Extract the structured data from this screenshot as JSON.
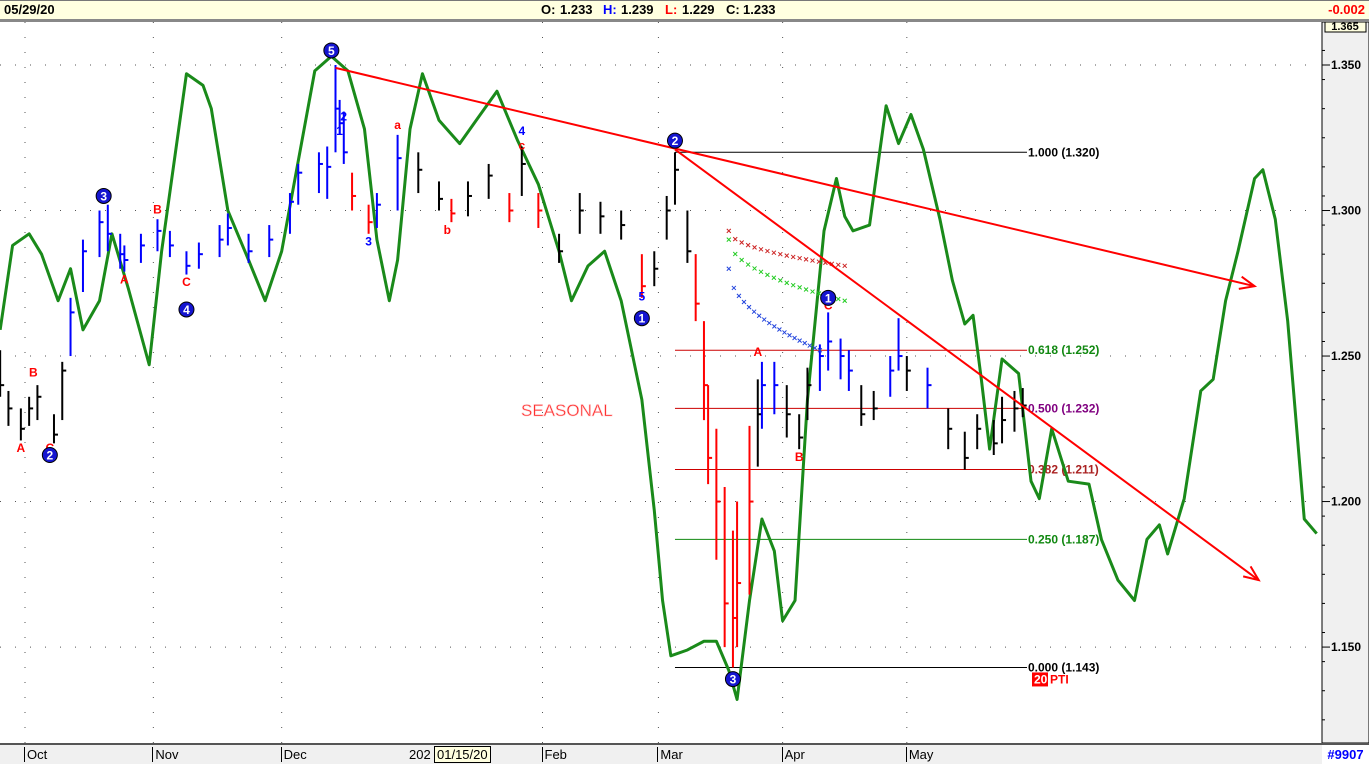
{
  "header": {
    "date": "05/29/20",
    "ohlc": {
      "o_label": "O:",
      "o": "1.233",
      "h_label": "H:",
      "h": "1.239",
      "l_label": "L:",
      "l": "1.229",
      "c_label": "C:",
      "c": "1.233"
    },
    "change": "-0.002",
    "colors": {
      "h": "#0000ff",
      "l": "#ff0000",
      "change": "#ff0000"
    }
  },
  "footer": {
    "cursor_date": "01/15/20",
    "year_label": "202",
    "id_label": "#9907"
  },
  "chart_data": {
    "type": "ohlc-bar",
    "ylim": [
      1.12,
      1.365
    ],
    "y_top_label": "1.365",
    "yticks": [
      1.15,
      1.2,
      1.25,
      1.3,
      1.35
    ],
    "ytick_labels": [
      "1.150",
      "1.200",
      "1.250",
      "1.300",
      "1.350"
    ],
    "xticks": [
      {
        "date": "2019-10-01",
        "label": "Oct"
      },
      {
        "date": "2019-11-01",
        "label": "Nov"
      },
      {
        "date": "2019-12-02",
        "label": "Dec"
      },
      {
        "date": "2020-02-03",
        "label": "Feb"
      },
      {
        "date": "2020-03-02",
        "label": "Mar"
      },
      {
        "date": "2020-04-01",
        "label": "Apr"
      },
      {
        "date": "2020-05-01",
        "label": "May"
      }
    ],
    "grid": true,
    "colors": {
      "black": "#000000",
      "blue": "#0000ff",
      "red": "#ff0000",
      "seasonal": "#1a8a1a",
      "trend": "#ff0000"
    },
    "bars": [
      [
        "2019-09-25",
        1.252,
        1.236,
        1.24,
        "black"
      ],
      [
        "2019-09-27",
        1.238,
        1.226,
        1.232,
        "black"
      ],
      [
        "2019-09-30",
        1.232,
        1.221,
        1.225,
        "black"
      ],
      [
        "2019-10-02",
        1.236,
        1.226,
        1.232,
        "black"
      ],
      [
        "2019-10-04",
        1.24,
        1.228,
        1.236,
        "black"
      ],
      [
        "2019-10-08",
        1.23,
        1.22,
        1.223,
        "black"
      ],
      [
        "2019-10-10",
        1.248,
        1.228,
        1.245,
        "black"
      ],
      [
        "2019-10-12",
        1.27,
        1.25,
        1.265,
        "blue"
      ],
      [
        "2019-10-15",
        1.29,
        1.272,
        1.286,
        "blue"
      ],
      [
        "2019-10-19",
        1.3,
        1.284,
        1.296,
        "blue"
      ],
      [
        "2019-10-21",
        1.302,
        1.286,
        1.292,
        "blue"
      ],
      [
        "2019-10-24",
        1.292,
        1.28,
        1.285,
        "blue"
      ],
      [
        "2019-10-25",
        1.288,
        1.279,
        1.283,
        "blue"
      ],
      [
        "2019-10-29",
        1.292,
        1.282,
        1.288,
        "blue"
      ],
      [
        "2019-11-02",
        1.297,
        1.286,
        1.293,
        "blue"
      ],
      [
        "2019-11-05",
        1.293,
        1.284,
        1.288,
        "blue"
      ],
      [
        "2019-11-09",
        1.286,
        1.278,
        1.281,
        "blue"
      ],
      [
        "2019-11-12",
        1.289,
        1.28,
        1.285,
        "blue"
      ],
      [
        "2019-11-17",
        1.295,
        1.284,
        1.29,
        "blue"
      ],
      [
        "2019-11-19",
        1.299,
        1.288,
        1.294,
        "blue"
      ],
      [
        "2019-11-24",
        1.292,
        1.282,
        1.286,
        "blue"
      ],
      [
        "2019-11-29",
        1.295,
        1.284,
        1.29,
        "blue"
      ],
      [
        "2019-12-04",
        1.306,
        1.292,
        1.303,
        "blue"
      ],
      [
        "2019-12-06",
        1.316,
        1.302,
        1.313,
        "blue"
      ],
      [
        "2019-12-11",
        1.32,
        1.306,
        1.316,
        "blue"
      ],
      [
        "2019-12-13",
        1.322,
        1.304,
        1.315,
        "blue"
      ],
      [
        "2019-12-15",
        1.35,
        1.32,
        1.335,
        "blue"
      ],
      [
        "2019-12-16",
        1.338,
        1.326,
        1.33,
        "blue"
      ],
      [
        "2019-12-17",
        1.334,
        1.316,
        1.32,
        "blue"
      ],
      [
        "2019-12-19",
        1.313,
        1.3,
        1.305,
        "red"
      ],
      [
        "2019-12-23",
        1.302,
        1.292,
        1.296,
        "red"
      ],
      [
        "2019-12-25",
        1.306,
        1.294,
        1.302,
        "blue"
      ],
      [
        "2019-12-30",
        1.326,
        1.3,
        1.318,
        "blue"
      ],
      [
        "2020-01-04",
        1.32,
        1.306,
        1.314,
        "black"
      ],
      [
        "2020-01-09",
        1.31,
        1.3,
        1.304,
        "black"
      ],
      [
        "2020-01-12",
        1.304,
        1.296,
        1.299,
        "red"
      ],
      [
        "2020-01-16",
        1.31,
        1.298,
        1.305,
        "black"
      ],
      [
        "2020-01-21",
        1.316,
        1.304,
        1.312,
        "black"
      ],
      [
        "2020-01-26",
        1.306,
        1.296,
        1.3,
        "red"
      ],
      [
        "2020-01-29",
        1.322,
        1.305,
        1.316,
        "black"
      ],
      [
        "2020-02-02",
        1.306,
        1.294,
        1.3,
        "red"
      ],
      [
        "2020-02-07",
        1.292,
        1.282,
        1.286,
        "black"
      ],
      [
        "2020-02-12",
        1.306,
        1.292,
        1.3,
        "black"
      ],
      [
        "2020-02-17",
        1.303,
        1.292,
        1.298,
        "black"
      ],
      [
        "2020-02-22",
        1.3,
        1.29,
        1.295,
        "black"
      ],
      [
        "2020-02-27",
        1.285,
        1.27,
        1.274,
        "red"
      ],
      [
        "2020-03-01",
        1.286,
        1.274,
        1.28,
        "black"
      ],
      [
        "2020-03-04",
        1.305,
        1.29,
        1.3,
        "black"
      ],
      [
        "2020-03-06",
        1.32,
        1.302,
        1.314,
        "black"
      ],
      [
        "2020-03-09",
        1.3,
        1.282,
        1.286,
        "black"
      ],
      [
        "2020-03-11",
        1.285,
        1.262,
        1.268,
        "red"
      ],
      [
        "2020-03-13",
        1.262,
        1.228,
        1.24,
        "red"
      ],
      [
        "2020-03-14",
        1.24,
        1.206,
        1.215,
        "red"
      ],
      [
        "2020-03-16",
        1.225,
        1.18,
        1.2,
        "red"
      ],
      [
        "2020-03-18",
        1.205,
        1.15,
        1.165,
        "red"
      ],
      [
        "2020-03-20",
        1.19,
        1.143,
        1.16,
        "red"
      ],
      [
        "2020-03-21",
        1.2,
        1.15,
        1.172,
        "red"
      ],
      [
        "2020-03-24",
        1.226,
        1.168,
        1.2,
        "red"
      ],
      [
        "2020-03-26",
        1.242,
        1.212,
        1.23,
        "black"
      ],
      [
        "2020-03-27",
        1.248,
        1.225,
        1.24,
        "blue"
      ],
      [
        "2020-03-30",
        1.248,
        1.23,
        1.24,
        "blue"
      ],
      [
        "2020-04-02",
        1.24,
        1.222,
        1.23,
        "black"
      ],
      [
        "2020-04-05",
        1.23,
        1.218,
        1.222,
        "black"
      ],
      [
        "2020-04-07",
        1.246,
        1.228,
        1.24,
        "black"
      ],
      [
        "2020-04-10",
        1.254,
        1.238,
        1.25,
        "blue"
      ],
      [
        "2020-04-12",
        1.265,
        1.245,
        1.255,
        "blue"
      ],
      [
        "2020-04-15",
        1.256,
        1.242,
        1.25,
        "blue"
      ],
      [
        "2020-04-17",
        1.252,
        1.238,
        1.245,
        "blue"
      ],
      [
        "2020-04-20",
        1.24,
        1.226,
        1.23,
        "black"
      ],
      [
        "2020-04-23",
        1.238,
        1.228,
        1.232,
        "black"
      ],
      [
        "2020-04-27",
        1.25,
        1.236,
        1.245,
        "blue"
      ],
      [
        "2020-04-29",
        1.263,
        1.245,
        1.25,
        "blue"
      ],
      [
        "2020-05-01",
        1.25,
        1.238,
        1.245,
        "black"
      ],
      [
        "2020-05-06",
        1.246,
        1.232,
        1.24,
        "blue"
      ],
      [
        "2020-05-11",
        1.232,
        1.218,
        1.225,
        "black"
      ],
      [
        "2020-05-15",
        1.224,
        1.211,
        1.215,
        "black"
      ],
      [
        "2020-05-18",
        1.23,
        1.218,
        1.225,
        "black"
      ],
      [
        "2020-05-22",
        1.228,
        1.216,
        1.22,
        "black"
      ],
      [
        "2020-05-24",
        1.236,
        1.22,
        1.228,
        "black"
      ],
      [
        "2020-05-27",
        1.238,
        1.224,
        1.232,
        "black"
      ],
      [
        "2020-05-29",
        1.239,
        1.229,
        1.233,
        "black"
      ]
    ],
    "seasonal": {
      "label": "SEASONAL",
      "points": [
        [
          "2019-09-25",
          1.259
        ],
        [
          "2019-09-28",
          1.288
        ],
        [
          "2019-10-02",
          1.292
        ],
        [
          "2019-10-05",
          1.285
        ],
        [
          "2019-10-09",
          1.269
        ],
        [
          "2019-10-12",
          1.28
        ],
        [
          "2019-10-15",
          1.259
        ],
        [
          "2019-10-19",
          1.269
        ],
        [
          "2019-10-22",
          1.292
        ],
        [
          "2019-10-26",
          1.273
        ],
        [
          "2019-10-31",
          1.247
        ],
        [
          "2019-11-03",
          1.286
        ],
        [
          "2019-11-09",
          1.347
        ],
        [
          "2019-11-13",
          1.343
        ],
        [
          "2019-11-15",
          1.335
        ],
        [
          "2019-11-19",
          1.3
        ],
        [
          "2019-11-24",
          1.283
        ],
        [
          "2019-11-28",
          1.269
        ],
        [
          "2019-12-02",
          1.286
        ],
        [
          "2019-12-06",
          1.317
        ],
        [
          "2019-12-10",
          1.348
        ],
        [
          "2019-12-14",
          1.353
        ],
        [
          "2019-12-18",
          1.348
        ],
        [
          "2019-12-22",
          1.328
        ],
        [
          "2019-12-25",
          1.29
        ],
        [
          "2019-12-28",
          1.269
        ],
        [
          "2019-12-30",
          1.283
        ],
        [
          "2020-01-02",
          1.328
        ],
        [
          "2020-01-05",
          1.347
        ],
        [
          "2020-01-09",
          1.331
        ],
        [
          "2020-01-14",
          1.323
        ],
        [
          "2020-01-18",
          1.331
        ],
        [
          "2020-01-23",
          1.341
        ],
        [
          "2020-01-28",
          1.324
        ],
        [
          "2020-02-02",
          1.309
        ],
        [
          "2020-02-07",
          1.286
        ],
        [
          "2020-02-10",
          1.269
        ],
        [
          "2020-02-14",
          1.281
        ],
        [
          "2020-02-18",
          1.286
        ],
        [
          "2020-02-22",
          1.269
        ],
        [
          "2020-02-27",
          1.235
        ],
        [
          "2020-03-01",
          1.197
        ],
        [
          "2020-03-03",
          1.166
        ],
        [
          "2020-03-05",
          1.147
        ],
        [
          "2020-03-09",
          1.149
        ],
        [
          "2020-03-13",
          1.152
        ],
        [
          "2020-03-16",
          1.152
        ],
        [
          "2020-03-19",
          1.142
        ],
        [
          "2020-03-21",
          1.132
        ],
        [
          "2020-03-24",
          1.166
        ],
        [
          "2020-03-27",
          1.194
        ],
        [
          "2020-03-30",
          1.183
        ],
        [
          "2020-04-01",
          1.159
        ],
        [
          "2020-04-04",
          1.166
        ],
        [
          "2020-04-07",
          1.235
        ],
        [
          "2020-04-11",
          1.293
        ],
        [
          "2020-04-14",
          1.311
        ],
        [
          "2020-04-16",
          1.298
        ],
        [
          "2020-04-18",
          1.293
        ],
        [
          "2020-04-22",
          1.295
        ],
        [
          "2020-04-26",
          1.336
        ],
        [
          "2020-04-29",
          1.323
        ],
        [
          "2020-05-02",
          1.333
        ],
        [
          "2020-05-05",
          1.321
        ],
        [
          "2020-05-09",
          1.297
        ],
        [
          "2020-05-12",
          1.276
        ],
        [
          "2020-05-15",
          1.261
        ],
        [
          "2020-05-17",
          1.264
        ],
        [
          "2020-05-19",
          1.242
        ],
        [
          "2020-05-21",
          1.218
        ],
        [
          "2020-05-24",
          1.249
        ],
        [
          "2020-05-28",
          1.244
        ],
        [
          "2020-05-31",
          1.207
        ],
        [
          "2020-06-02",
          1.201
        ],
        [
          "2020-06-05",
          1.225
        ],
        [
          "2020-06-09",
          1.207
        ],
        [
          "2020-06-14",
          1.206
        ],
        [
          "2020-06-17",
          1.187
        ],
        [
          "2020-06-21",
          1.173
        ],
        [
          "2020-06-25",
          1.166
        ],
        [
          "2020-06-28",
          1.187
        ],
        [
          "2020-07-01",
          1.192
        ],
        [
          "2020-07-03",
          1.182
        ],
        [
          "2020-07-07",
          1.201
        ],
        [
          "2020-07-11",
          1.238
        ],
        [
          "2020-07-14",
          1.242
        ],
        [
          "2020-07-17",
          1.269
        ],
        [
          "2020-07-20",
          1.286
        ],
        [
          "2020-07-24",
          1.311
        ],
        [
          "2020-07-26",
          1.314
        ],
        [
          "2020-07-29",
          1.297
        ],
        [
          "2020-08-01",
          1.262
        ],
        [
          "2020-08-05",
          1.194
        ],
        [
          "2020-08-08",
          1.189
        ]
      ]
    },
    "trendlines": [
      {
        "from": [
          "2019-12-15",
          1.349
        ],
        "to": [
          "2020-07-24",
          1.274
        ]
      },
      {
        "from": [
          "2020-03-06",
          1.321
        ],
        "to": [
          "2020-07-25",
          1.173
        ]
      }
    ],
    "projections": [
      {
        "color": "#cc2222",
        "from": [
          "2020-03-19",
          1.293
        ],
        "to": [
          "2020-04-16",
          1.281
        ]
      },
      {
        "color": "#22cc22",
        "from": [
          "2020-03-19",
          1.29
        ],
        "to": [
          "2020-04-16",
          1.269
        ]
      },
      {
        "color": "#2244dd",
        "from": [
          "2020-03-19",
          1.28
        ],
        "to": [
          "2020-04-10",
          1.252
        ]
      }
    ],
    "fibonacci": {
      "start_date": "2020-03-06",
      "end_date": "2020-05-29",
      "levels": [
        {
          "label": "1.000 (1.320)",
          "value": 1.32,
          "line": "#000000",
          "text": "#000000"
        },
        {
          "label": "0.618 (1.252)",
          "value": 1.252,
          "line": "#cc0000",
          "text": "#118811"
        },
        {
          "label": "0.500 (1.232)",
          "value": 1.232,
          "line": "#cc0000",
          "text": "#800080"
        },
        {
          "label": "0.382 (1.211)",
          "value": 1.211,
          "line": "#cc0000",
          "text": "#aa2222"
        },
        {
          "label": "0.250 (1.187)",
          "value": 1.187,
          "line": "#118811",
          "text": "#118811"
        },
        {
          "label": "0.000 (1.143)",
          "value": 1.143,
          "line": "#000000",
          "text": "#000000"
        }
      ]
    },
    "pti": {
      "value": "20",
      "label": "PTI"
    },
    "wave_circles": [
      {
        "t": "2",
        "date": "2019-10-07",
        "v": 1.216
      },
      {
        "t": "3",
        "date": "2019-10-20",
        "v": 1.305
      },
      {
        "t": "4",
        "date": "2019-11-09",
        "v": 1.266
      },
      {
        "t": "5",
        "date": "2019-12-14",
        "v": 1.355
      },
      {
        "t": "1",
        "date": "2020-02-27",
        "v": 1.263
      },
      {
        "t": "2",
        "date": "2020-03-06",
        "v": 1.324
      },
      {
        "t": "1",
        "date": "2020-04-12",
        "v": 1.27
      },
      {
        "t": "3",
        "date": "2020-03-20",
        "v": 1.139
      }
    ],
    "wave_labels": [
      {
        "t": "A",
        "date": "2019-09-30",
        "v": 1.217,
        "c": "red"
      },
      {
        "t": "B",
        "date": "2019-10-03",
        "v": 1.243,
        "c": "red"
      },
      {
        "t": "C",
        "date": "2019-10-07",
        "v": 1.217,
        "c": "red"
      },
      {
        "t": "A",
        "date": "2019-10-25",
        "v": 1.275,
        "c": "red"
      },
      {
        "t": "B",
        "date": "2019-11-02",
        "v": 1.299,
        "c": "red"
      },
      {
        "t": "C",
        "date": "2019-11-09",
        "v": 1.274,
        "c": "red"
      },
      {
        "t": "1",
        "date": "2019-12-16",
        "v": 1.326,
        "c": "blue"
      },
      {
        "t": "2",
        "date": "2019-12-17",
        "v": 1.331,
        "c": "blue"
      },
      {
        "t": "3",
        "date": "2019-12-23",
        "v": 1.288,
        "c": "blue"
      },
      {
        "t": "a",
        "date": "2019-12-30",
        "v": 1.328,
        "c": "red"
      },
      {
        "t": "b",
        "date": "2020-01-11",
        "v": 1.292,
        "c": "red"
      },
      {
        "t": "4",
        "date": "2020-01-29",
        "v": 1.326,
        "c": "blue"
      },
      {
        "t": "c",
        "date": "2020-01-29",
        "v": 1.321,
        "c": "red"
      },
      {
        "t": "5",
        "date": "2020-02-27",
        "v": 1.269,
        "c": "blue"
      },
      {
        "t": "A",
        "date": "2020-03-26",
        "v": 1.25,
        "c": "red"
      },
      {
        "t": "B",
        "date": "2020-04-05",
        "v": 1.214,
        "c": "red"
      },
      {
        "t": "C",
        "date": "2020-04-12",
        "v": 1.266,
        "c": "red"
      }
    ]
  }
}
